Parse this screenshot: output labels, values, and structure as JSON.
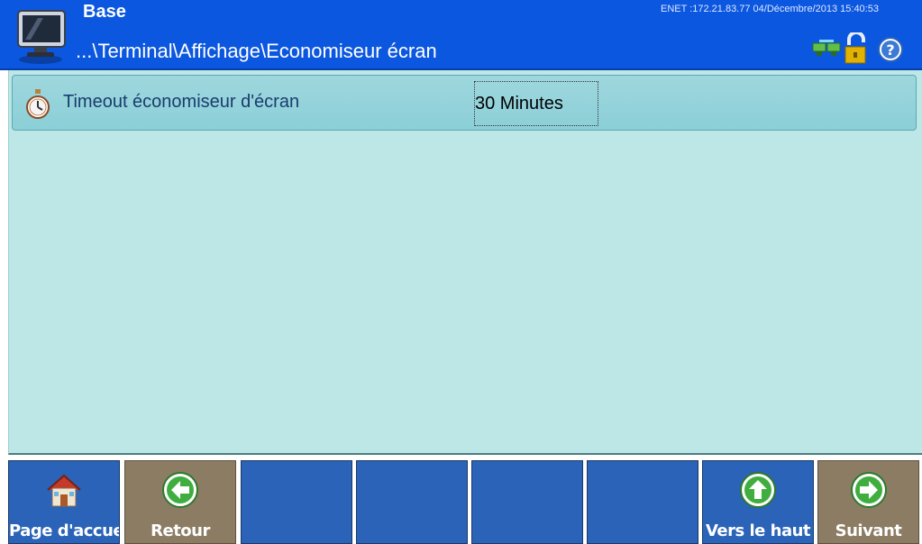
{
  "header": {
    "title": "Base",
    "path": "...\\Terminal\\Affichage\\Economiseur écran",
    "status": "ENET :172.21.83.77  04/Décembre/2013 15:40:53",
    "icons": [
      "network-icon",
      "unlock-icon",
      "help-icon"
    ]
  },
  "setting": {
    "icon": "stopwatch-icon",
    "label": "Timeout économiseur d'écran",
    "value": "30 Minutes"
  },
  "softkeys": [
    {
      "label": "Page d'accueil",
      "icon": "home-icon"
    },
    {
      "label": "Retour",
      "icon": "arrow-left-icon"
    },
    {
      "label": ""
    },
    {
      "label": ""
    },
    {
      "label": ""
    },
    {
      "label": ""
    },
    {
      "label": "Vers le haut",
      "icon": "arrow-up-icon"
    },
    {
      "label": "Suivant",
      "icon": "arrow-right-icon"
    }
  ],
  "colors": {
    "header": "#0b57e0",
    "content": "#bde7e6",
    "key_blue": "#2a63b7",
    "key_tan": "#8c7c63"
  }
}
